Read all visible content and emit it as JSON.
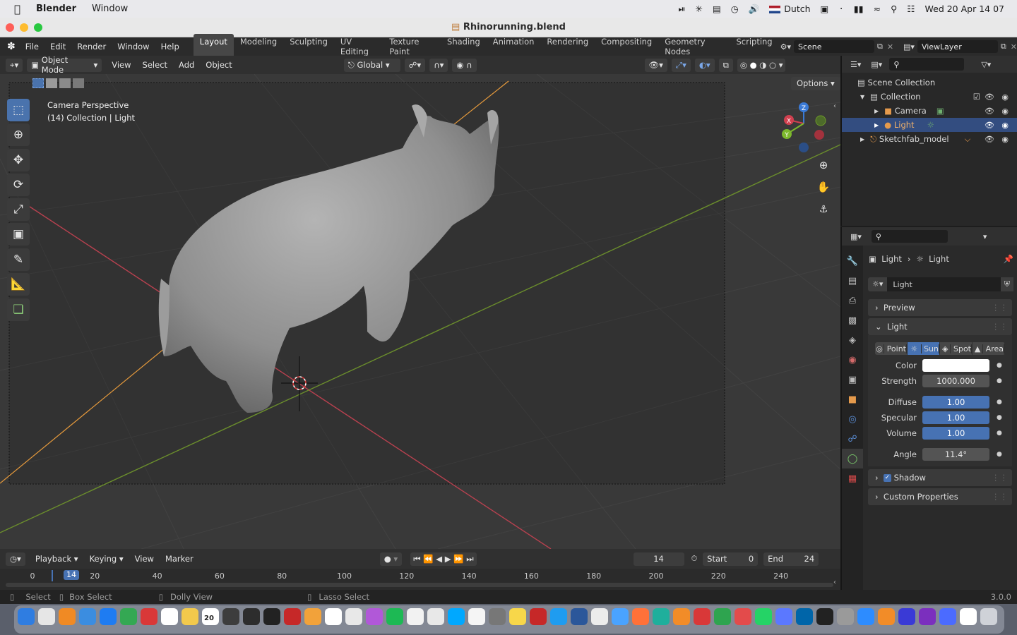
{
  "mac_menubar": {
    "app_name": "Blender",
    "menu": "Window",
    "input_source": "Dutch",
    "datetime": "Wed 20 Apr  14 07"
  },
  "window": {
    "title": "Rhinorunning.blend"
  },
  "topbar": {
    "menus": [
      "File",
      "Edit",
      "Render",
      "Window",
      "Help"
    ],
    "workspaces": [
      "Layout",
      "Modeling",
      "Sculpting",
      "UV Editing",
      "Texture Paint",
      "Shading",
      "Animation",
      "Rendering",
      "Compositing",
      "Geometry Nodes",
      "Scripting"
    ],
    "active_workspace": "Layout",
    "scene": "Scene",
    "view_layer": "ViewLayer"
  },
  "viewport_header": {
    "mode": "Object Mode",
    "menus": [
      "View",
      "Select",
      "Add",
      "Object"
    ],
    "transform_orientation": "Global"
  },
  "viewport": {
    "options_label": "Options",
    "overlay_line1": "Camera Perspective",
    "overlay_line2": "(14) Collection | Light",
    "axis_gizmo": {
      "x": "X",
      "y": "Y",
      "z": "Z"
    }
  },
  "outliner": {
    "root": "Scene Collection",
    "items": [
      {
        "label": "Collection"
      },
      {
        "label": "Camera"
      },
      {
        "label": "Light",
        "selected": true
      },
      {
        "label": "Sketchfab_model"
      }
    ]
  },
  "properties": {
    "breadcrumb_object": "Light",
    "breadcrumb_data": "Light",
    "datablock": "Light",
    "panels": {
      "preview": "Preview",
      "light": "Light",
      "shadow": "Shadow",
      "custom": "Custom Properties"
    },
    "light_types": [
      "Point",
      "Sun",
      "Spot",
      "Area"
    ],
    "active_light_type": "Sun",
    "fields": {
      "color_label": "Color",
      "color_value": "#ffffff",
      "strength_label": "Strength",
      "strength": "1000.000",
      "diffuse_label": "Diffuse",
      "diffuse": "1.00",
      "specular_label": "Specular",
      "specular": "1.00",
      "volume_label": "Volume",
      "volume": "1.00",
      "angle_label": "Angle",
      "angle": "11.4°"
    },
    "shadow_enabled": true
  },
  "timeline": {
    "menus": [
      "Playback",
      "Keying",
      "View",
      "Marker"
    ],
    "current_frame": "14",
    "start_label": "Start",
    "start": "0",
    "end_label": "End",
    "end": "24",
    "ruler": [
      "0",
      "20",
      "40",
      "60",
      "80",
      "100",
      "120",
      "140",
      "160",
      "180",
      "200",
      "220",
      "240"
    ]
  },
  "statusbar": {
    "select": "Select",
    "box_select": "Box Select",
    "dolly_view": "Dolly View",
    "lasso_select": "Lasso Select",
    "version": "3.0.0"
  },
  "dock": {
    "calendar_day": "20"
  }
}
